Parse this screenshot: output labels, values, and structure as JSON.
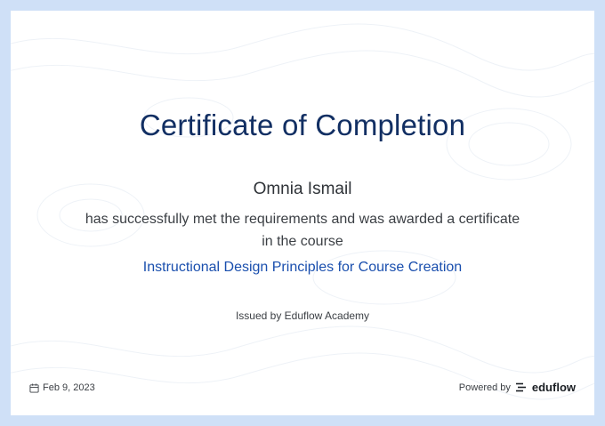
{
  "certificate": {
    "title": "Certificate of Completion",
    "recipient_name": "Omnia Ismail",
    "description": "has successfully met the requirements and was awarded a certificate in the course",
    "course_title": "Instructional Design Principles for Course Creation",
    "issued_by": "Issued by Eduflow Academy"
  },
  "footer": {
    "date": "Feb 9, 2023",
    "date_icon": "calendar-icon",
    "powered_by_label": "Powered by",
    "brand_icon": "eduflow-logo-icon",
    "brand_name": "eduflow"
  },
  "colors": {
    "background": "#cfe0f7",
    "title": "#122f63",
    "course": "#1a4fae"
  }
}
